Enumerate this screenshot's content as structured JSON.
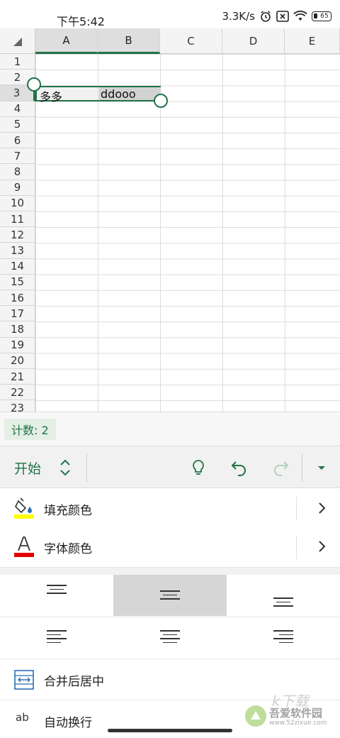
{
  "status_bar": {
    "time": "下午5:42",
    "network_speed": "3.3K/s",
    "battery_level": "65"
  },
  "sheet": {
    "columns": [
      "A",
      "B",
      "C",
      "D",
      "E"
    ],
    "rows": [
      "1",
      "2",
      "3",
      "4",
      "5",
      "6",
      "7",
      "8",
      "9",
      "10",
      "11",
      "12",
      "13",
      "14",
      "15",
      "16",
      "17",
      "18",
      "19",
      "20",
      "21",
      "22",
      "23"
    ],
    "cells": {
      "A3": "多多",
      "B3": "ddooo"
    },
    "selected_range": "A3:B3"
  },
  "status": {
    "count_label": "计数: 2"
  },
  "toolbar": {
    "tab_label": "开始",
    "accent_color": "#217346"
  },
  "panel": {
    "fill_color_label": "填充颜色",
    "fill_color_value": "#ffff00",
    "font_color_label": "字体颜色",
    "font_color_value": "#e00000",
    "merge_center_label": "合并后居中",
    "wrap_text_label": "自动换行",
    "wrap_icon_text": "ab",
    "vertical_align_selected": "middle"
  },
  "watermark": {
    "title": "吾爱软件园",
    "url": "www.52zixue.com",
    "logo_text": "k下载"
  }
}
